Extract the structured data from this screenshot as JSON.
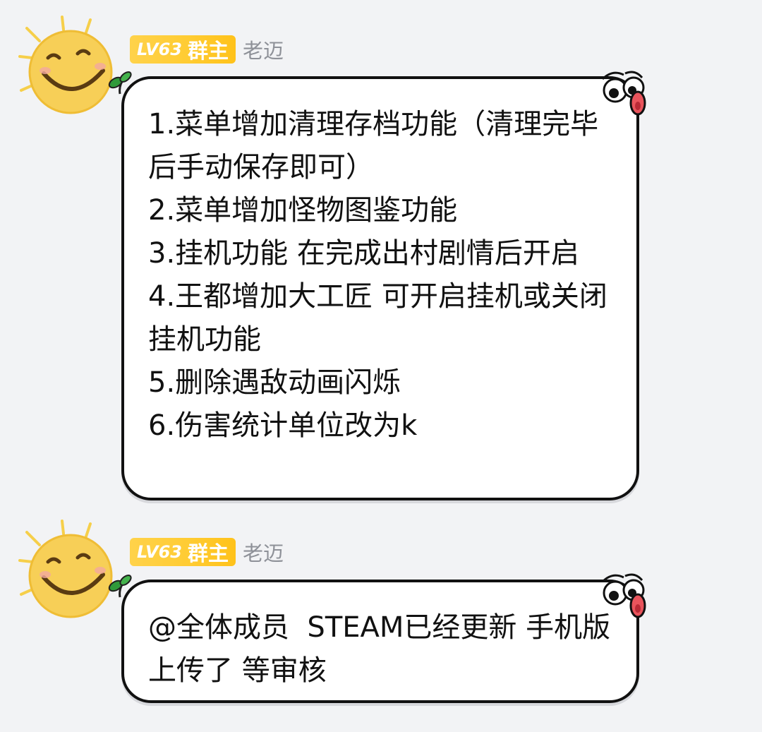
{
  "messages": [
    {
      "level": "LV63",
      "role": "群主",
      "nickname": "老迈",
      "text": "1.菜单增加清理存档功能（清理完毕后手动保存即可）\n2.菜单增加怪物图鉴功能\n3.挂机功能 在完成出村剧情后开启\n4.王都增加大工匠 可开启挂机或关闭挂机功能\n5.删除遇敌动画闪烁\n6.伤害统计单位改为k"
    },
    {
      "level": "LV63",
      "role": "群主",
      "nickname": "老迈",
      "text": "@全体成员  STEAM已经更新 手机版上传了 等审核"
    }
  ],
  "colors": {
    "badge": "#ffc933",
    "nickname": "#8e9198",
    "bubble_border": "#111111",
    "background": "#f2f3f5"
  },
  "icons": {
    "avatar": "smiling-sun-avatar",
    "bubble_corner_left": "sprout-icon",
    "bubble_corner_right": "googly-eyes-icon"
  }
}
